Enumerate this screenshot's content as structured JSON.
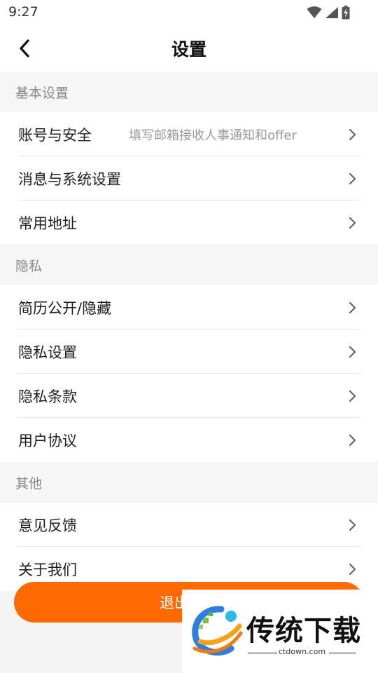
{
  "status_bar": {
    "time": "9:27"
  },
  "header": {
    "title": "设置"
  },
  "sections": {
    "basic": {
      "title": "基本设置",
      "items": [
        {
          "label": "账号与安全",
          "hint": "填写邮箱接收人事通知和offer"
        },
        {
          "label": "消息与系统设置"
        },
        {
          "label": "常用地址"
        }
      ]
    },
    "privacy": {
      "title": "隐私",
      "items": [
        {
          "label": "简历公开/隐藏"
        },
        {
          "label": "隐私设置"
        },
        {
          "label": "隐私条款"
        },
        {
          "label": "用户协议"
        }
      ]
    },
    "other": {
      "title": "其他",
      "items": [
        {
          "label": "意见反馈"
        },
        {
          "label": "关于我们"
        }
      ]
    }
  },
  "logout": {
    "label": "退出登录"
  },
  "watermark": {
    "brand": "传统下载",
    "domain": "ctdown.com"
  },
  "colors": {
    "accent": "#ff6a00",
    "section_bg": "#f6f6f6",
    "hint": "#999999"
  },
  "icons": [
    "wifi-icon",
    "cellular-signal-icon",
    "battery-charging-icon",
    "back-arrow-icon",
    "chevron-right-icon"
  ]
}
